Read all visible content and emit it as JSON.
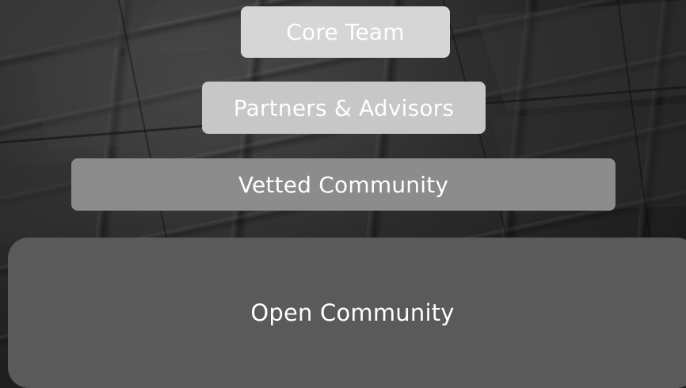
{
  "tiers": {
    "core": {
      "label": "Core Team"
    },
    "partners": {
      "label": "Partners & Advisors"
    },
    "vetted": {
      "label": "Vetted Community"
    },
    "open": {
      "label": "Open Community"
    }
  },
  "colors": {
    "core": "#d6d6d6",
    "partners": "#c7c7c7",
    "vetted": "#8c8c8c",
    "open": "#5a5a5a",
    "text": "#ffffff"
  }
}
